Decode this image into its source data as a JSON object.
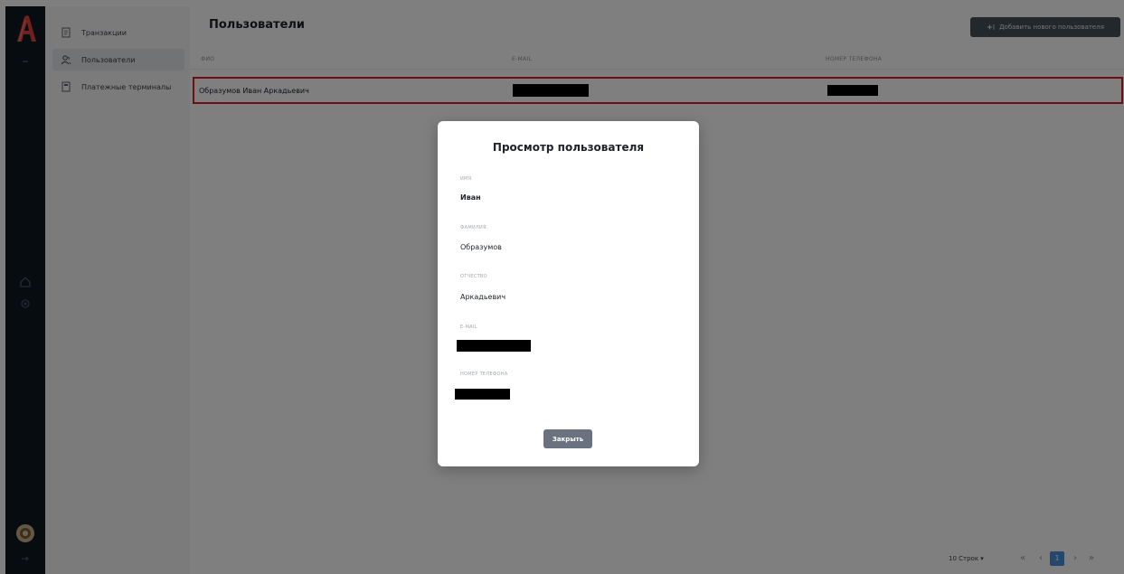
{
  "sidebar": {
    "items": [
      {
        "label": "Транзакции",
        "icon": "document-icon"
      },
      {
        "label": "Пользователи",
        "icon": "users-icon",
        "active": true
      },
      {
        "label": "Платежные терминалы",
        "icon": "terminal-icon"
      }
    ],
    "rail_icons": [
      "logo",
      "collapse-icon",
      "home-icon",
      "settings-icon",
      "avatar",
      "logout-icon"
    ]
  },
  "header": {
    "title": "Пользователи",
    "add_button_label": "Добавить нового пользователя"
  },
  "table": {
    "columns": [
      "ФИО",
      "E-mail",
      "Номер телефона"
    ],
    "rows": [
      {
        "name": "Образумов Иван Аркадьевич",
        "email": "",
        "phone": ""
      }
    ]
  },
  "pagination": {
    "rows_per_page": "10 Строк",
    "first": "«",
    "prev": "‹",
    "current_page": "1",
    "next": "›",
    "last": "»"
  },
  "modal": {
    "title": "Просмотр пользователя",
    "fields": [
      {
        "label": "Имя",
        "value": "Иван"
      },
      {
        "label": "Фамилия",
        "value": "Образумов"
      },
      {
        "label": "Отчество",
        "value": "Аркадьевич"
      },
      {
        "label": "E-mail",
        "value": ""
      },
      {
        "label": "Номер телефона",
        "value": ""
      }
    ],
    "close_label": "Закрыть"
  },
  "colors": {
    "rail_bg": "#0f1922",
    "brand_logo": "#e0413d",
    "highlight_border": "#d71e25",
    "primary_button": "#47505b",
    "close_button": "#6a7280",
    "page_active": "#4a8fd6"
  }
}
